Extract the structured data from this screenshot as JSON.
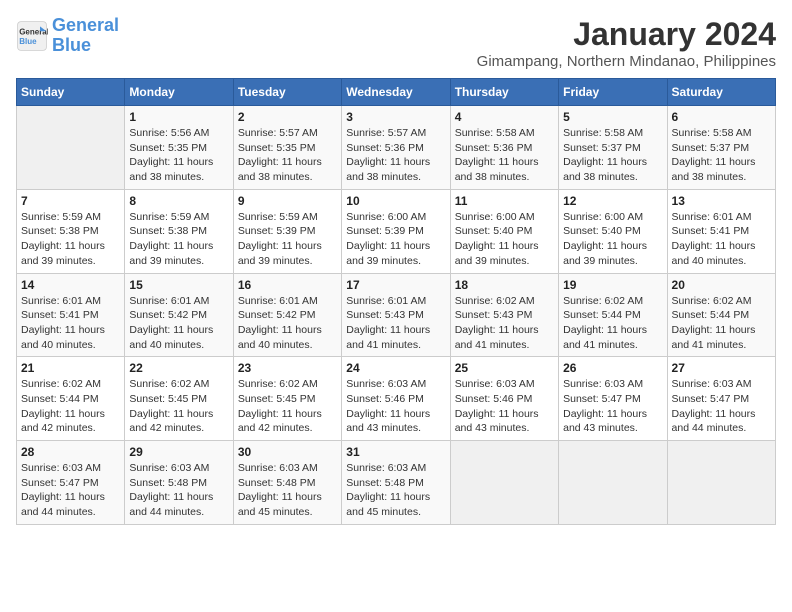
{
  "header": {
    "logo_line1": "General",
    "logo_line2": "Blue",
    "month": "January 2024",
    "location": "Gimampang, Northern Mindanao, Philippines"
  },
  "columns": [
    "Sunday",
    "Monday",
    "Tuesday",
    "Wednesday",
    "Thursday",
    "Friday",
    "Saturday"
  ],
  "weeks": [
    [
      {
        "day": "",
        "info": ""
      },
      {
        "day": "1",
        "info": "Sunrise: 5:56 AM\nSunset: 5:35 PM\nDaylight: 11 hours\nand 38 minutes."
      },
      {
        "day": "2",
        "info": "Sunrise: 5:57 AM\nSunset: 5:35 PM\nDaylight: 11 hours\nand 38 minutes."
      },
      {
        "day": "3",
        "info": "Sunrise: 5:57 AM\nSunset: 5:36 PM\nDaylight: 11 hours\nand 38 minutes."
      },
      {
        "day": "4",
        "info": "Sunrise: 5:58 AM\nSunset: 5:36 PM\nDaylight: 11 hours\nand 38 minutes."
      },
      {
        "day": "5",
        "info": "Sunrise: 5:58 AM\nSunset: 5:37 PM\nDaylight: 11 hours\nand 38 minutes."
      },
      {
        "day": "6",
        "info": "Sunrise: 5:58 AM\nSunset: 5:37 PM\nDaylight: 11 hours\nand 38 minutes."
      }
    ],
    [
      {
        "day": "7",
        "info": "Sunrise: 5:59 AM\nSunset: 5:38 PM\nDaylight: 11 hours\nand 39 minutes."
      },
      {
        "day": "8",
        "info": "Sunrise: 5:59 AM\nSunset: 5:38 PM\nDaylight: 11 hours\nand 39 minutes."
      },
      {
        "day": "9",
        "info": "Sunrise: 5:59 AM\nSunset: 5:39 PM\nDaylight: 11 hours\nand 39 minutes."
      },
      {
        "day": "10",
        "info": "Sunrise: 6:00 AM\nSunset: 5:39 PM\nDaylight: 11 hours\nand 39 minutes."
      },
      {
        "day": "11",
        "info": "Sunrise: 6:00 AM\nSunset: 5:40 PM\nDaylight: 11 hours\nand 39 minutes."
      },
      {
        "day": "12",
        "info": "Sunrise: 6:00 AM\nSunset: 5:40 PM\nDaylight: 11 hours\nand 39 minutes."
      },
      {
        "day": "13",
        "info": "Sunrise: 6:01 AM\nSunset: 5:41 PM\nDaylight: 11 hours\nand 40 minutes."
      }
    ],
    [
      {
        "day": "14",
        "info": "Sunrise: 6:01 AM\nSunset: 5:41 PM\nDaylight: 11 hours\nand 40 minutes."
      },
      {
        "day": "15",
        "info": "Sunrise: 6:01 AM\nSunset: 5:42 PM\nDaylight: 11 hours\nand 40 minutes."
      },
      {
        "day": "16",
        "info": "Sunrise: 6:01 AM\nSunset: 5:42 PM\nDaylight: 11 hours\nand 40 minutes."
      },
      {
        "day": "17",
        "info": "Sunrise: 6:01 AM\nSunset: 5:43 PM\nDaylight: 11 hours\nand 41 minutes."
      },
      {
        "day": "18",
        "info": "Sunrise: 6:02 AM\nSunset: 5:43 PM\nDaylight: 11 hours\nand 41 minutes."
      },
      {
        "day": "19",
        "info": "Sunrise: 6:02 AM\nSunset: 5:44 PM\nDaylight: 11 hours\nand 41 minutes."
      },
      {
        "day": "20",
        "info": "Sunrise: 6:02 AM\nSunset: 5:44 PM\nDaylight: 11 hours\nand 41 minutes."
      }
    ],
    [
      {
        "day": "21",
        "info": "Sunrise: 6:02 AM\nSunset: 5:44 PM\nDaylight: 11 hours\nand 42 minutes."
      },
      {
        "day": "22",
        "info": "Sunrise: 6:02 AM\nSunset: 5:45 PM\nDaylight: 11 hours\nand 42 minutes."
      },
      {
        "day": "23",
        "info": "Sunrise: 6:02 AM\nSunset: 5:45 PM\nDaylight: 11 hours\nand 42 minutes."
      },
      {
        "day": "24",
        "info": "Sunrise: 6:03 AM\nSunset: 5:46 PM\nDaylight: 11 hours\nand 43 minutes."
      },
      {
        "day": "25",
        "info": "Sunrise: 6:03 AM\nSunset: 5:46 PM\nDaylight: 11 hours\nand 43 minutes."
      },
      {
        "day": "26",
        "info": "Sunrise: 6:03 AM\nSunset: 5:47 PM\nDaylight: 11 hours\nand 43 minutes."
      },
      {
        "day": "27",
        "info": "Sunrise: 6:03 AM\nSunset: 5:47 PM\nDaylight: 11 hours\nand 44 minutes."
      }
    ],
    [
      {
        "day": "28",
        "info": "Sunrise: 6:03 AM\nSunset: 5:47 PM\nDaylight: 11 hours\nand 44 minutes."
      },
      {
        "day": "29",
        "info": "Sunrise: 6:03 AM\nSunset: 5:48 PM\nDaylight: 11 hours\nand 44 minutes."
      },
      {
        "day": "30",
        "info": "Sunrise: 6:03 AM\nSunset: 5:48 PM\nDaylight: 11 hours\nand 45 minutes."
      },
      {
        "day": "31",
        "info": "Sunrise: 6:03 AM\nSunset: 5:48 PM\nDaylight: 11 hours\nand 45 minutes."
      },
      {
        "day": "",
        "info": ""
      },
      {
        "day": "",
        "info": ""
      },
      {
        "day": "",
        "info": ""
      }
    ]
  ]
}
